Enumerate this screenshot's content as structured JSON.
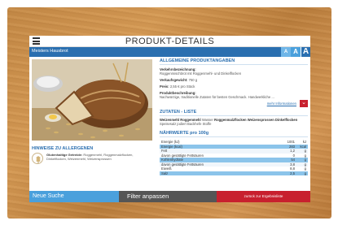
{
  "header": {
    "title": "PRODUKT-DETAILS",
    "product_name": "Meisters Hausbrot"
  },
  "font_size_buttons": [
    "A",
    "A",
    "A"
  ],
  "general": {
    "heading": "ALLGEMEINE PRODUKTANGABEN",
    "designation_label": "Verkehrsbezeichnung:",
    "designation_value": "Roggenmischbrot mit Roggenmehl- und Dinkelflocken",
    "weight_label": "Verkaufsgewicht:",
    "weight_value": "750 g",
    "price_label": "Preis:",
    "price_value": "2,55 € pro Stück",
    "description_label": "Produktbeschreibung:",
    "description_value": "Nachwürzige, traditionelle Zutaten für besten Geschmack. Handwerkliche ..."
  },
  "more_info": {
    "link": "mehr Informationen",
    "icon": "chevron-down-icon"
  },
  "ingredients": {
    "heading": "ZUTATEN - LISTE",
    "items": [
      "Weizenmehl",
      "Roggenmehl",
      "Wasser",
      "Roggenmalzflocken",
      "Weizensprossen",
      "Dinkelflocken",
      "Speisesalz jodiert",
      "Backhefe",
      "Stoffe"
    ]
  },
  "nutrition": {
    "heading": "NÄHRWERTE pro 100g",
    "rows": [
      {
        "name": "Energie (kJ)",
        "value": "1001",
        "unit": "kJ",
        "style": "plain"
      },
      {
        "name": "Energie (kcal)",
        "value": "283",
        "unit": "kcal",
        "style": "hl"
      },
      {
        "name": "Fett",
        "value": "1,2",
        "unit": "g",
        "style": "alt"
      },
      {
        "name": "davon gesättigte Fettsäuren",
        "value": "0",
        "unit": "g",
        "style": "plain"
      },
      {
        "name": "Kohlenhydrate",
        "value": "54",
        "unit": "g",
        "style": "hl"
      },
      {
        "name": "davon gesättigte Fettsäuren",
        "value": "3,8",
        "unit": "g",
        "style": "alt"
      },
      {
        "name": "Eiweiß",
        "value": "8,8",
        "unit": "g",
        "style": "plain"
      },
      {
        "name": "Salz",
        "value": "2,5",
        "unit": "g",
        "style": "hl"
      }
    ]
  },
  "allergens": {
    "heading": "HINWEISE ZU ALLERGENEN",
    "title": "Glutenhaltige Getreide:",
    "text": "Roggenmehl, Roggenmalzflocken, Dinkelflocken, Weizenmehl, Weizensprossen"
  },
  "bottom": {
    "new_search": "Neue Suche",
    "filter": "Filter anpassen",
    "back": "zurück zur Ergebnisliste"
  },
  "colors": {
    "blue": "#2a6fb0",
    "light_blue": "#4aa0dc",
    "red": "#c8202e",
    "dark": "#555555"
  }
}
